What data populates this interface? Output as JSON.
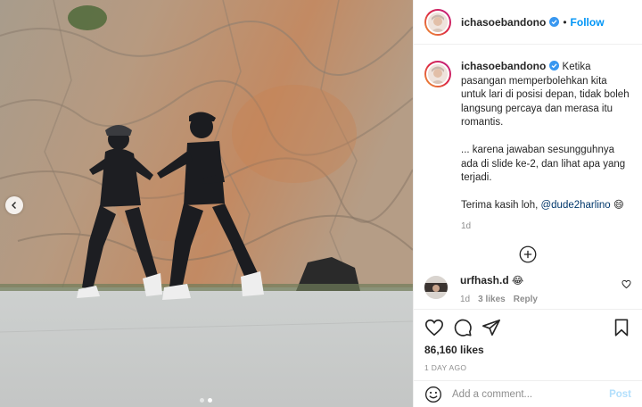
{
  "post": {
    "author": "ichasoebandono",
    "follow_label": "Follow",
    "separator": "•",
    "caption": "Ketika pasangan memperbolehkan kita untuk lari di posisi depan, tidak boleh langsung percaya dan merasa itu romantis.\n\n... karena jawaban sesungguhnya ada di slide ke-2, dan lihat apa yang terjadi.\n\nTerima kasih loh, ",
    "caption_mention": "@dude2harlino",
    "caption_emoji": "😄",
    "caption_age": "1d",
    "likes": "86,160 likes",
    "date": "1 DAY AGO",
    "carousel": {
      "slides": 2,
      "current": 2
    }
  },
  "comment": {
    "author": "urfhash.d",
    "text": "😂",
    "age": "1d",
    "likes_label": "3 likes",
    "reply_label": "Reply"
  },
  "add_comment": {
    "placeholder": "Add a comment...",
    "post_label": "Post"
  },
  "icons": {
    "verified": "verified-badge-icon",
    "prev": "chevron-left-icon",
    "more": "plus-circle-icon",
    "like": "heart-icon",
    "comment": "comment-icon",
    "share": "paper-plane-icon",
    "save": "bookmark-icon",
    "emoji": "smiley-icon"
  },
  "colors": {
    "accent": "#0095f6",
    "verified": "#3897f0",
    "post_disabled": "#b2dffc",
    "muted": "#8e8e8e"
  }
}
